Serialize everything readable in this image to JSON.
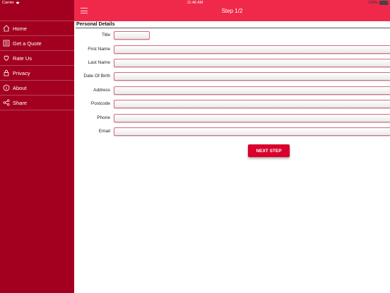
{
  "status_bar": {
    "carrier": "Carrier",
    "time": "11:46 AM",
    "battery": "100%"
  },
  "header": {
    "title": "Step 1/2"
  },
  "sidebar": {
    "items": [
      {
        "label": "Home",
        "icon": "home-icon"
      },
      {
        "label": "Get a Quote",
        "icon": "quote-icon"
      },
      {
        "label": "Rate Us",
        "icon": "rate-icon"
      },
      {
        "label": "Privacy",
        "icon": "lock-icon"
      },
      {
        "label": "About",
        "icon": "info-icon"
      },
      {
        "label": "Share",
        "icon": "share-icon"
      }
    ]
  },
  "form": {
    "section_title": "Personal Details",
    "fields": {
      "title": {
        "label": "Title",
        "value": ""
      },
      "first_name": {
        "label": "First Name",
        "value": ""
      },
      "last_name": {
        "label": "Last Name",
        "value": ""
      },
      "dob": {
        "label": "Date Of Birth",
        "value": ""
      },
      "address": {
        "label": "Address",
        "value": ""
      },
      "postcode": {
        "label": "Postcode",
        "value": ""
      },
      "phone": {
        "label": "Phone",
        "value": ""
      },
      "email": {
        "label": "Email",
        "value": ""
      }
    },
    "next_label": "NEXT STEP"
  },
  "colors": {
    "sidebar": "#a30020",
    "header": "#f0294a",
    "button": "#d9002c"
  }
}
